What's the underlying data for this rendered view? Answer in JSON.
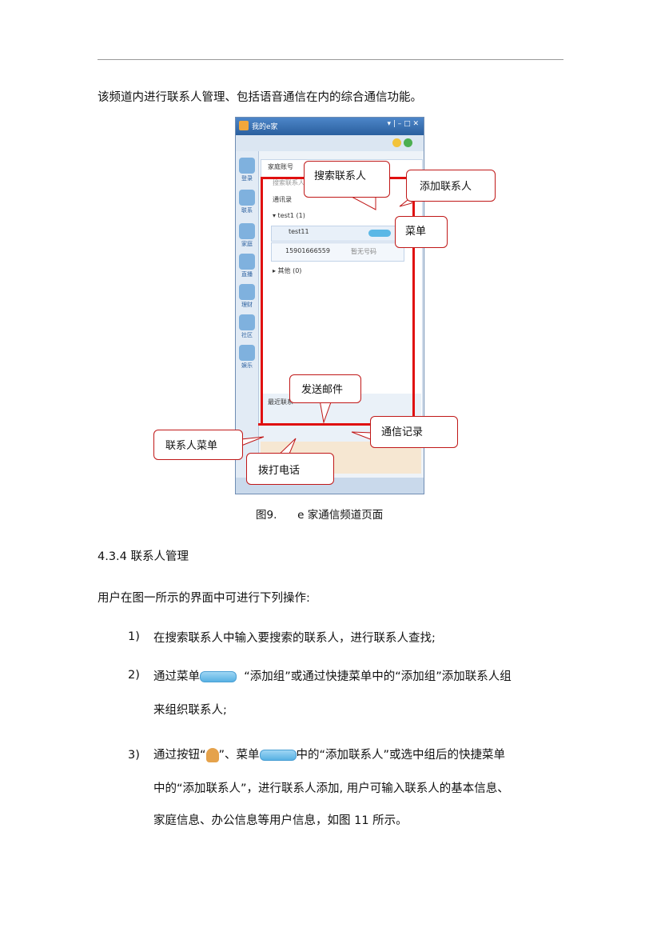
{
  "intro": "该频道内进行联系人管理、包括语音通信在内的综合通信功能。",
  "screenshot": {
    "window_title": "我的e家",
    "window_controls": "▾ | – □ ✕",
    "panel_header": "家庭账号",
    "search_placeholder": "搜索联系人",
    "tab_label": "通讯录",
    "group_1": "▾ test1 (1)",
    "contact_name": "test11",
    "contact_phone": "15901666559",
    "contact_status": "暂无号码",
    "group_2": "▸ 其他 (0)",
    "recent_label": "最近联系",
    "sidebar_items": [
      "登录",
      "联系",
      "家庭",
      "直播",
      "理财",
      "社区",
      "娱乐"
    ]
  },
  "callouts": {
    "search": "搜索联系人",
    "add_contact": "添加联系人",
    "menu": "菜单",
    "send_mail": "发送邮件",
    "comm_record": "通信记录",
    "contact_menu": "联系人菜单",
    "dial": "拨打电话"
  },
  "caption": "图9.      e 家通信频道页面",
  "section_heading": "4.3.4 联系人管理",
  "lead": "用户在图一所示的界面中可进行下列操作:",
  "list": [
    {
      "num": "1)",
      "line1": "在搜索联系人中输入要搜索的联系人，进行联系人查找;"
    },
    {
      "num": "2)",
      "pre": "通过菜单",
      "post": "  “添加组”或通过快捷菜单中的“添加组”添加联系人组",
      "line2": "来组织联系人;"
    },
    {
      "num": "3)",
      "pre": "通过按钮“",
      "mid": "”、菜单",
      "post": "中的“添加联系人”或选中组后的快捷菜单",
      "line2": "中的“添加联系人”，进行联系人添加, 用户可输入联系人的基本信息、",
      "line3": "家庭信息、办公信息等用户信息，如图 11 所示。"
    }
  ],
  "colors": {
    "callout_border": "#c01818",
    "highlight": "#e01010",
    "window_blue": "#2a5f9e"
  }
}
